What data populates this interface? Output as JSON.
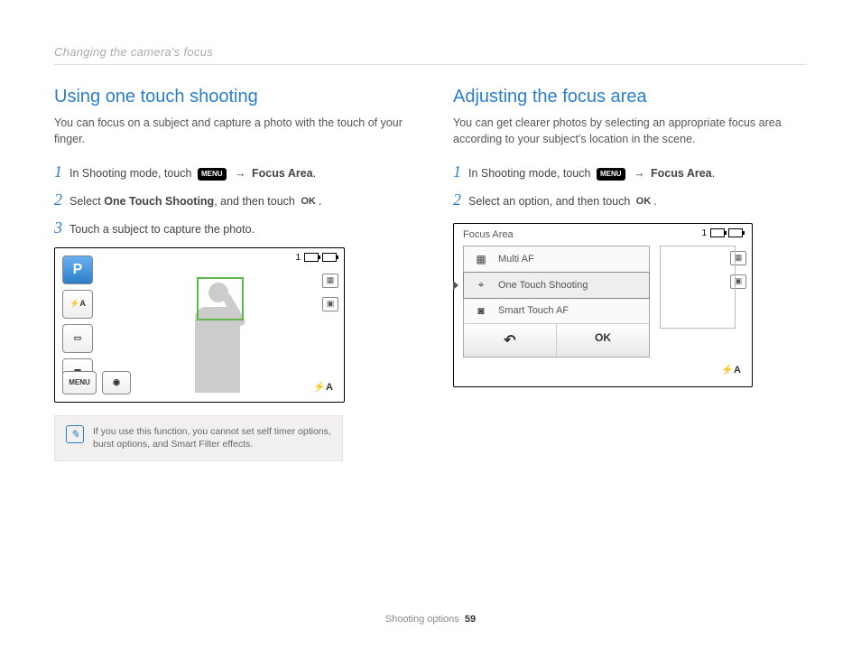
{
  "header": "Changing the camera's focus",
  "left": {
    "heading": "Using one touch shooting",
    "intro": "You can focus on a subject and capture a photo with the touch of your finger.",
    "steps": {
      "s1a": "In Shooting mode, touch ",
      "s1b": " → ",
      "s1c": "Focus Area",
      "s2a": "Select ",
      "s2b": "One Touch Shooting",
      "s2c": ", and then touch ",
      "s3": "Touch a subject to capture the photo."
    },
    "menu_label": "MENU",
    "ok_label": "OK",
    "screen": {
      "counter": "1",
      "p_mode": "P",
      "btn_flash": "⚡A",
      "btn_wb": "▭",
      "btn_iso": "▦",
      "menu": "MENU",
      "view": "◉",
      "flash_br": "⚡A"
    },
    "note": "If you use this function, you cannot set self timer options, burst options, and Smart Filter effects."
  },
  "right": {
    "heading": "Adjusting the focus area",
    "intro": "You can get clearer photos by selecting an appropriate focus area according to your subject's location in the scene.",
    "steps": {
      "s1a": "In Shooting mode, touch ",
      "s1b": " → ",
      "s1c": "Focus Area",
      "s2a": "Select an option, and then touch "
    },
    "menu_label": "MENU",
    "ok_label": "OK",
    "screen": {
      "title": "Focus Area",
      "counter": "1",
      "options": {
        "multi_af": "Multi AF",
        "one_touch": "One Touch Shooting",
        "smart_touch": "Smart Touch AF"
      },
      "back": "↶",
      "ok": "OK",
      "flash_br": "⚡A"
    }
  },
  "footer": {
    "section": "Shooting options",
    "page": "59"
  }
}
